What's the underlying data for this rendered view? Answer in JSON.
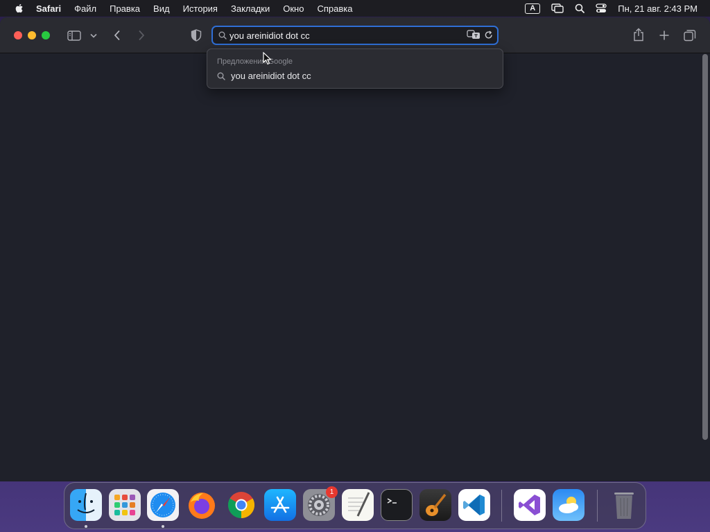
{
  "menubar": {
    "app_name": "Safari",
    "items": [
      "Файл",
      "Правка",
      "Вид",
      "История",
      "Закладки",
      "Окно",
      "Справка"
    ],
    "input_source": "A",
    "clock": "Пн, 21 авг.  2:43 PM"
  },
  "toolbar": {
    "address_value": "you areinidiot dot cc"
  },
  "suggestions": {
    "header": "Предложения Google",
    "items": [
      "you areinidiot dot cc"
    ]
  },
  "dock": {
    "apps": [
      "finder",
      "launchpad",
      "safari",
      "firefox",
      "chrome",
      "app-store",
      "system-settings",
      "textedit",
      "terminal",
      "garageband",
      "vscode",
      "visual-studio",
      "weather",
      "trash"
    ],
    "system_settings_badge": "1"
  },
  "colors": {
    "accent": "#2f6fd6",
    "window_bg": "#1f212a",
    "toolbar_bg": "#2a2b31",
    "badge": "#e8382f"
  }
}
